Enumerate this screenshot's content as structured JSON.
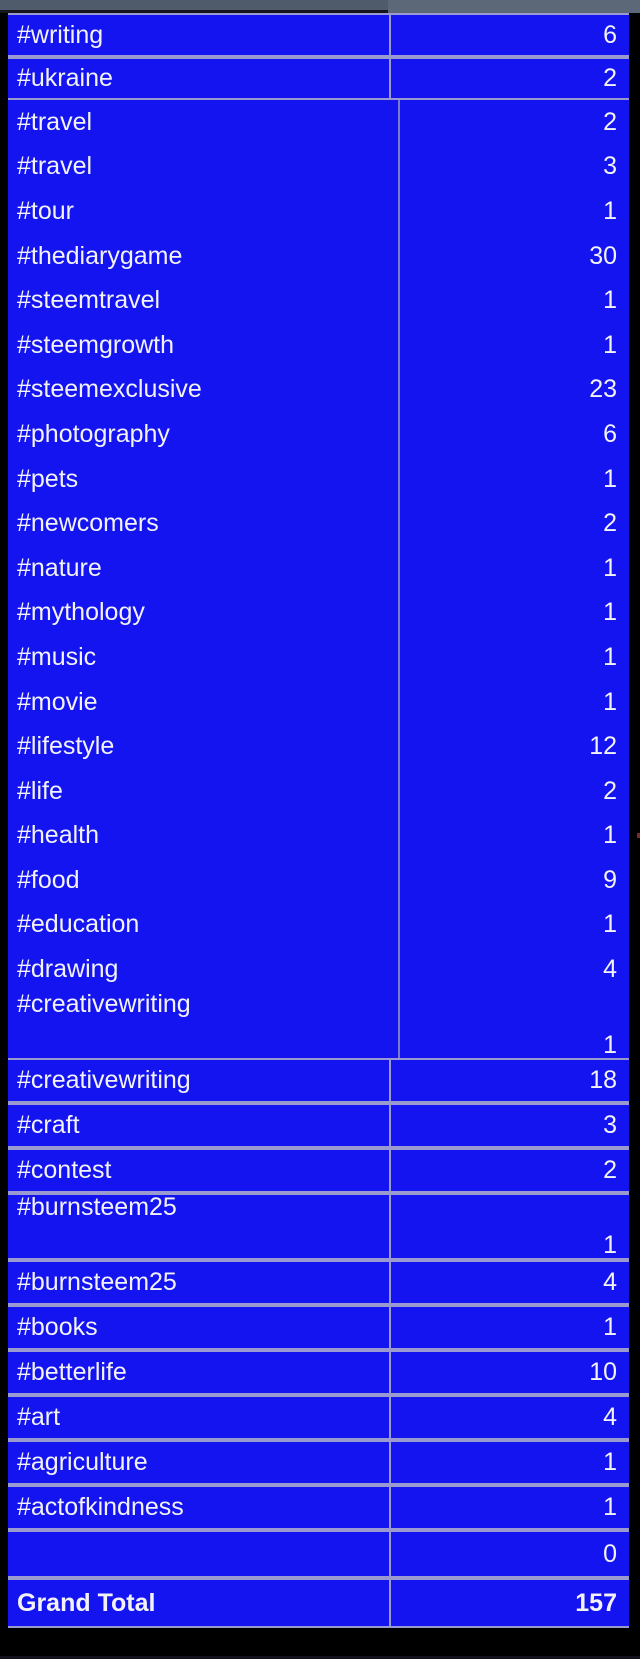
{
  "colors": {
    "cell_fill": "#1414f0",
    "grid_line": "#9a9ad0",
    "text": "#f2f2f8",
    "topbar_left": "#4f5b6b",
    "topbar_right": "#5c6878",
    "frame": "#000000"
  },
  "table": {
    "sections": [
      {
        "id": "top-bordered",
        "style": "bordered",
        "rows": [
          {
            "label": "#writing",
            "value": "6"
          },
          {
            "label": "#ukraine",
            "value": "2"
          }
        ]
      },
      {
        "id": "middle-borderless",
        "style": "borderless",
        "rows": [
          {
            "label": "#travel",
            "value": "2"
          },
          {
            "label": "#travel",
            "value": "3"
          },
          {
            "label": "#tour",
            "value": "1"
          },
          {
            "label": "#thediarygame",
            "value": "30"
          },
          {
            "label": "#steemtravel",
            "value": "1"
          },
          {
            "label": "#steemgrowth",
            "value": "1"
          },
          {
            "label": "#steemexclusive",
            "value": "23"
          },
          {
            "label": "#photography",
            "value": "6"
          },
          {
            "label": "#pets",
            "value": "1"
          },
          {
            "label": "#newcomers",
            "value": "2"
          },
          {
            "label": "#nature",
            "value": "1"
          },
          {
            "label": "#mythology",
            "value": "1"
          },
          {
            "label": "#music",
            "value": "1"
          },
          {
            "label": "#movie",
            "value": "1"
          },
          {
            "label": "#lifestyle",
            "value": "12"
          },
          {
            "label": "#life",
            "value": "2"
          },
          {
            "label": "#health",
            "value": "1"
          },
          {
            "label": "#food",
            "value": "9"
          },
          {
            "label": "#education",
            "value": "1"
          },
          {
            "label": "#drawing",
            "value": "4"
          },
          {
            "label": "#creativewriting",
            "value": "1",
            "split": true
          }
        ]
      },
      {
        "id": "bottom-bordered",
        "style": "bordered",
        "rows": [
          {
            "label": "#creativewriting",
            "value": "18"
          },
          {
            "label": "#craft",
            "value": "3"
          },
          {
            "label": "#contest",
            "value": "2"
          },
          {
            "label": "#burnsteem25",
            "value": "1",
            "split": true
          },
          {
            "label": "#burnsteem25",
            "value": "4"
          },
          {
            "label": "#books",
            "value": "1"
          },
          {
            "label": "#betterlife",
            "value": "10"
          },
          {
            "label": "#art",
            "value": "4"
          },
          {
            "label": "#agriculture",
            "value": "1"
          },
          {
            "label": "#actofkindness",
            "value": "1"
          },
          {
            "label": "",
            "value": "0"
          },
          {
            "label": "Grand Total",
            "value": "157",
            "total": true
          }
        ]
      }
    ]
  }
}
